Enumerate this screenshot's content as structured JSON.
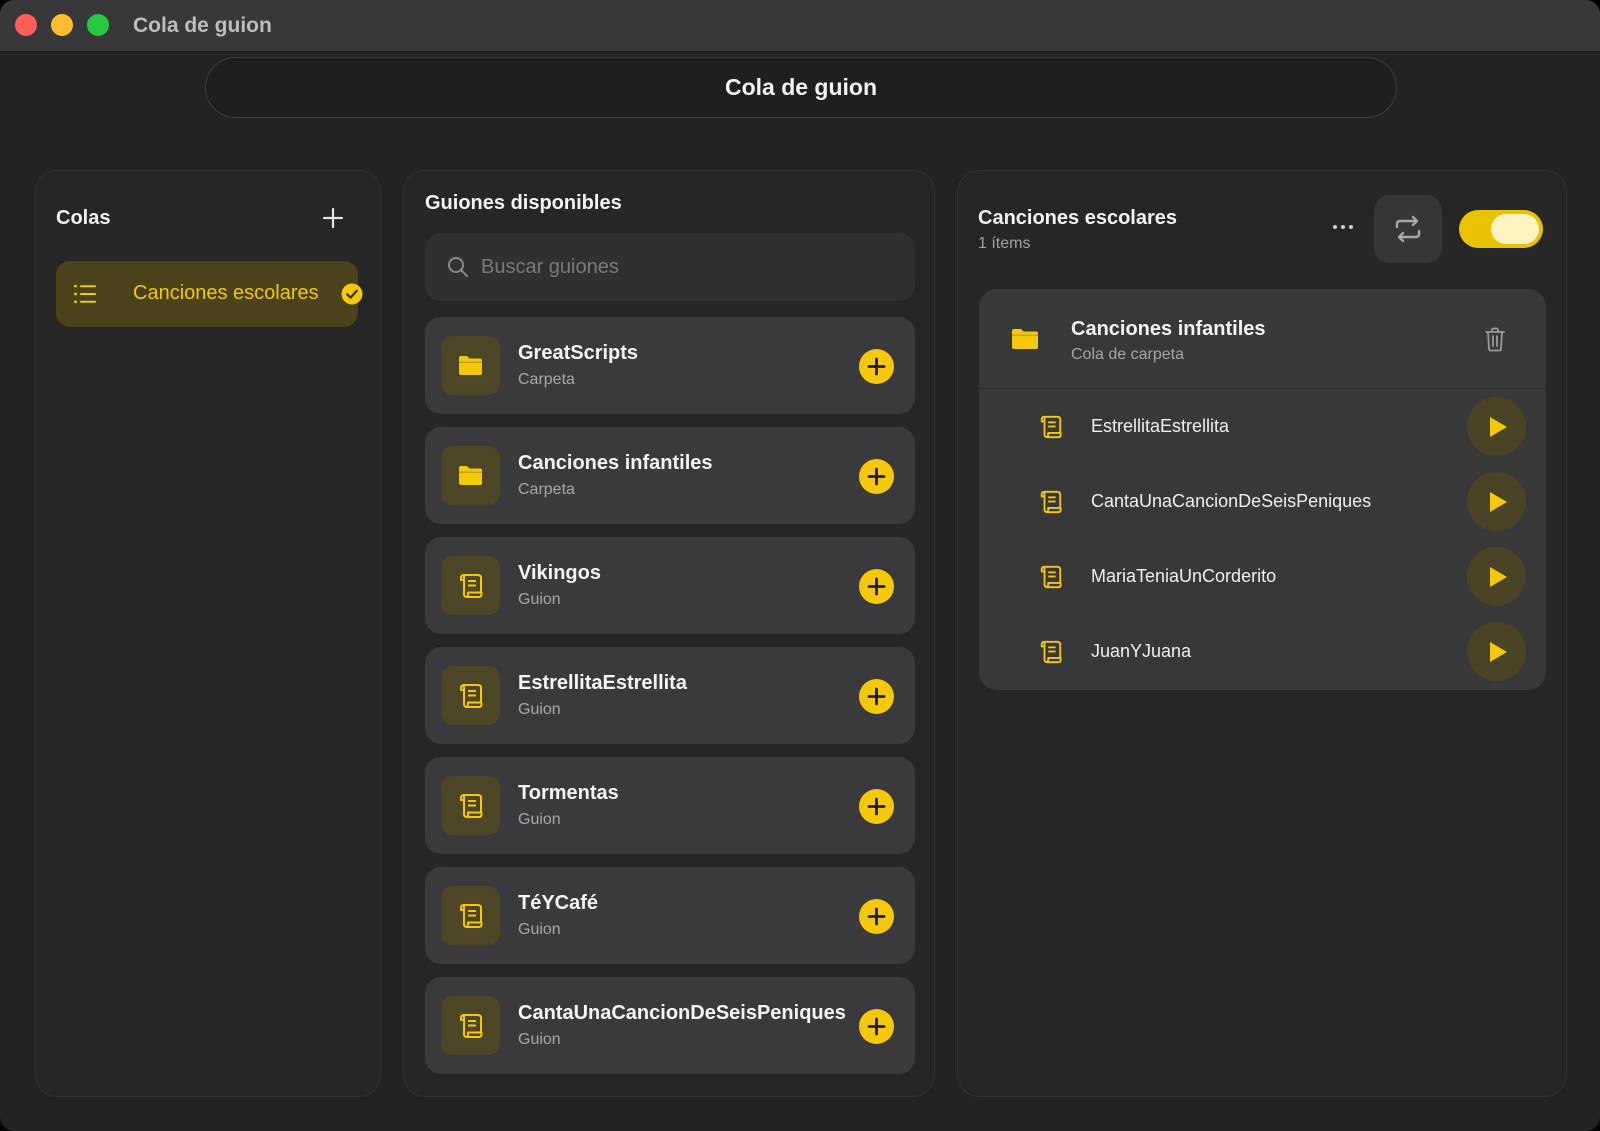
{
  "window": {
    "title": "Cola de guion"
  },
  "header": {
    "title": "Cola de guion"
  },
  "queues": {
    "title": "Colas",
    "items": [
      {
        "label": "Canciones escolares",
        "selected": true
      }
    ]
  },
  "scripts": {
    "title": "Guiones disponibles",
    "search_placeholder": "Buscar guiones",
    "items": [
      {
        "name": "GreatScripts",
        "kind": "Carpeta",
        "icon": "folder-icon"
      },
      {
        "name": "Canciones infantiles",
        "kind": "Carpeta",
        "icon": "folder-icon"
      },
      {
        "name": "Vikingos",
        "kind": "Guion",
        "icon": "scroll-icon"
      },
      {
        "name": "EstrellitaEstrellita",
        "kind": "Guion",
        "icon": "scroll-icon"
      },
      {
        "name": "Tormentas",
        "kind": "Guion",
        "icon": "scroll-icon"
      },
      {
        "name": "TéYCafé",
        "kind": "Guion",
        "icon": "scroll-icon"
      },
      {
        "name": "CantaUnaCancionDeSeisPeniques",
        "kind": "Guion",
        "icon": "scroll-icon"
      }
    ]
  },
  "detail": {
    "title": "Canciones escolares",
    "count": "1 ítems",
    "toggle_on": true,
    "folder": {
      "name": "Canciones infantiles",
      "kind": "Cola de carpeta",
      "tracks": [
        {
          "name": "EstrellitaEstrellita"
        },
        {
          "name": "CantaUnaCancionDeSeisPeniques"
        },
        {
          "name": "MariaTeniaUnCorderito"
        },
        {
          "name": "JuanYJuana"
        }
      ]
    }
  },
  "colors": {
    "accent": "#f5c90a",
    "panel": "#262627",
    "card": "#3a3a3c",
    "background": "#232324"
  }
}
